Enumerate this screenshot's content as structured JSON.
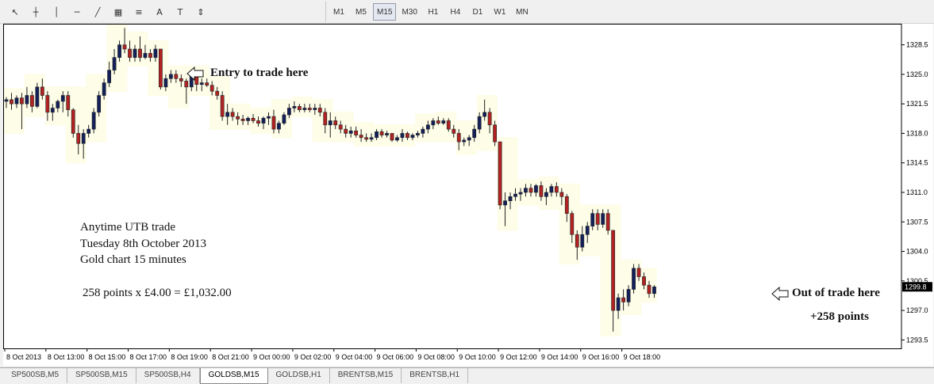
{
  "toolbar": {
    "tools": [
      {
        "name": "cursor-icon",
        "glyph": "↖"
      },
      {
        "name": "crosshair-icon",
        "glyph": "┼"
      },
      {
        "name": "vertical-line-icon",
        "glyph": "│"
      },
      {
        "name": "horizontal-line-icon",
        "glyph": "─"
      },
      {
        "name": "trendline-icon",
        "glyph": "╱"
      },
      {
        "name": "equidistant-channel-icon",
        "glyph": "▦"
      },
      {
        "name": "fibonacci-icon",
        "glyph": "≡"
      },
      {
        "name": "text-icon",
        "glyph": "A"
      },
      {
        "name": "text-label-icon",
        "glyph": "T"
      },
      {
        "name": "arrows-icon",
        "glyph": "⇕"
      }
    ],
    "timeframes": [
      "M1",
      "M5",
      "M15",
      "M30",
      "H1",
      "H4",
      "D1",
      "W1",
      "MN"
    ],
    "active_timeframe": "M15"
  },
  "chart_data": {
    "type": "candlestick",
    "symbol": "GOLDSB",
    "timeframe": "M15",
    "ylim": [
      1292.5,
      1331.0
    ],
    "y_ticks": [
      "1328.5",
      "1325.0",
      "1321.5",
      "1318.0",
      "1314.5",
      "1311.0",
      "1307.5",
      "1304.0",
      "1300.5",
      "1297.0",
      "1293.5"
    ],
    "current_price": "1299.8",
    "x_ticks": [
      "8 Oct 2013",
      "8 Oct 13:00",
      "8 Oct 15:00",
      "8 Oct 17:00",
      "8 Oct 19:00",
      "8 Oct 21:00",
      "9 Oct 00:00",
      "9 Oct 02:00",
      "9 Oct 04:00",
      "9 Oct 06:00",
      "9 Oct 08:00",
      "9 Oct 10:00",
      "9 Oct 12:00",
      "9 Oct 14:00",
      "9 Oct 16:00",
      "9 Oct 18:00"
    ],
    "candles": [
      [
        1321.8,
        1322.3,
        1321.0,
        1322.0
      ],
      [
        1322.0,
        1322.8,
        1320.8,
        1321.5
      ],
      [
        1321.5,
        1322.5,
        1321.0,
        1322.2
      ],
      [
        1322.2,
        1322.8,
        1318.5,
        1321.5
      ],
      [
        1321.5,
        1323.5,
        1321.0,
        1322.5
      ],
      [
        1322.5,
        1323.0,
        1320.5,
        1321.2
      ],
      [
        1321.2,
        1324.0,
        1321.0,
        1323.5
      ],
      [
        1323.5,
        1324.5,
        1322.0,
        1322.5
      ],
      [
        1322.5,
        1323.0,
        1319.5,
        1320.5
      ],
      [
        1320.5,
        1321.5,
        1319.5,
        1321.0
      ],
      [
        1321.0,
        1322.0,
        1320.5,
        1321.8
      ],
      [
        1321.8,
        1323.0,
        1320.5,
        1322.5
      ],
      [
        1322.5,
        1323.0,
        1320.0,
        1320.8
      ],
      [
        1320.8,
        1321.0,
        1317.5,
        1318.0
      ],
      [
        1318.0,
        1319.0,
        1315.5,
        1316.8
      ],
      [
        1316.8,
        1318.5,
        1315.0,
        1318.0
      ],
      [
        1318.0,
        1319.0,
        1317.5,
        1318.5
      ],
      [
        1318.5,
        1321.0,
        1318.0,
        1320.5
      ],
      [
        1320.5,
        1323.0,
        1320.0,
        1322.5
      ],
      [
        1322.5,
        1324.5,
        1322.0,
        1324.0
      ],
      [
        1324.0,
        1326.5,
        1323.5,
        1325.5
      ],
      [
        1325.5,
        1328.0,
        1325.0,
        1327.0
      ],
      [
        1327.0,
        1329.0,
        1326.5,
        1328.5
      ],
      [
        1328.5,
        1330.5,
        1327.5,
        1328.0
      ],
      [
        1328.0,
        1329.0,
        1326.5,
        1327.0
      ],
      [
        1327.0,
        1328.5,
        1326.5,
        1328.0
      ],
      [
        1328.0,
        1329.5,
        1326.5,
        1327.0
      ],
      [
        1327.0,
        1328.5,
        1326.8,
        1327.5
      ],
      [
        1327.5,
        1328.0,
        1326.5,
        1327.0
      ],
      [
        1327.0,
        1328.5,
        1326.5,
        1328.0
      ],
      [
        1328.0,
        1328.0,
        1323.2,
        1323.5
      ],
      [
        1323.5,
        1325.0,
        1323.0,
        1324.5
      ],
      [
        1324.5,
        1325.5,
        1324.0,
        1325.0
      ],
      [
        1325.0,
        1325.5,
        1324.0,
        1324.5
      ],
      [
        1324.5,
        1325.0,
        1323.5,
        1324.2
      ],
      [
        1324.2,
        1324.5,
        1321.5,
        1323.5
      ],
      [
        1323.5,
        1325.5,
        1323.0,
        1325.0
      ],
      [
        1325.0,
        1325.5,
        1323.0,
        1323.8
      ],
      [
        1323.8,
        1324.5,
        1323.0,
        1324.0
      ],
      [
        1324.0,
        1324.5,
        1323.5,
        1323.7
      ],
      [
        1323.7,
        1324.2,
        1322.5,
        1323.0
      ],
      [
        1323.0,
        1323.5,
        1322.0,
        1322.5
      ],
      [
        1322.5,
        1323.0,
        1319.5,
        1320.0
      ],
      [
        1320.0,
        1321.5,
        1319.0,
        1320.5
      ],
      [
        1320.5,
        1321.0,
        1319.5,
        1320.0
      ],
      [
        1320.0,
        1320.5,
        1319.0,
        1319.7
      ],
      [
        1319.7,
        1320.2,
        1319.0,
        1319.5
      ],
      [
        1319.5,
        1320.0,
        1319.0,
        1319.8
      ],
      [
        1319.8,
        1320.3,
        1319.2,
        1319.5
      ],
      [
        1319.5,
        1320.0,
        1318.8,
        1319.2
      ],
      [
        1319.2,
        1320.0,
        1318.5,
        1319.8
      ],
      [
        1319.8,
        1320.5,
        1319.0,
        1320.0
      ],
      [
        1320.0,
        1320.8,
        1318.0,
        1318.5
      ],
      [
        1318.5,
        1319.5,
        1318.0,
        1319.2
      ],
      [
        1319.2,
        1320.5,
        1319.0,
        1320.2
      ],
      [
        1320.2,
        1321.5,
        1319.8,
        1321.0
      ],
      [
        1321.0,
        1321.8,
        1320.5,
        1321.2
      ],
      [
        1321.2,
        1321.5,
        1320.5,
        1320.8
      ],
      [
        1320.8,
        1321.5,
        1320.5,
        1321.0
      ],
      [
        1321.0,
        1321.5,
        1320.5,
        1320.8
      ],
      [
        1320.8,
        1321.5,
        1320.2,
        1321.0
      ],
      [
        1321.0,
        1321.5,
        1320.0,
        1320.5
      ],
      [
        1320.5,
        1321.0,
        1318.0,
        1319.0
      ],
      [
        1319.0,
        1320.5,
        1317.5,
        1319.5
      ],
      [
        1319.5,
        1320.0,
        1318.5,
        1319.0
      ],
      [
        1319.0,
        1319.5,
        1318.0,
        1318.5
      ],
      [
        1318.5,
        1319.0,
        1317.5,
        1318.0
      ],
      [
        1318.0,
        1318.8,
        1317.5,
        1318.3
      ],
      [
        1318.3,
        1318.8,
        1317.5,
        1317.8
      ],
      [
        1317.8,
        1318.5,
        1317.0,
        1317.5
      ],
      [
        1317.5,
        1318.0,
        1317.0,
        1317.3
      ],
      [
        1317.3,
        1318.0,
        1317.0,
        1317.5
      ],
      [
        1317.5,
        1318.5,
        1317.2,
        1318.2
      ],
      [
        1318.2,
        1318.5,
        1317.5,
        1317.8
      ],
      [
        1317.8,
        1318.3,
        1317.5,
        1318.0
      ],
      [
        1318.0,
        1318.0,
        1317.0,
        1317.2
      ],
      [
        1317.2,
        1317.8,
        1317.0,
        1317.5
      ],
      [
        1317.5,
        1318.5,
        1317.0,
        1318.0
      ],
      [
        1318.0,
        1318.2,
        1317.2,
        1317.5
      ],
      [
        1317.5,
        1318.0,
        1317.2,
        1317.8
      ],
      [
        1317.8,
        1318.3,
        1317.5,
        1318.0
      ],
      [
        1318.0,
        1318.8,
        1317.5,
        1318.5
      ],
      [
        1318.5,
        1319.5,
        1318.0,
        1319.0
      ],
      [
        1319.0,
        1319.8,
        1318.5,
        1319.5
      ],
      [
        1319.5,
        1320.0,
        1319.0,
        1319.2
      ],
      [
        1319.2,
        1319.8,
        1319.0,
        1319.5
      ],
      [
        1319.5,
        1319.8,
        1318.2,
        1318.5
      ],
      [
        1318.5,
        1319.0,
        1317.5,
        1318.0
      ],
      [
        1318.0,
        1318.5,
        1316.0,
        1317.0
      ],
      [
        1317.0,
        1317.5,
        1316.5,
        1317.2
      ],
      [
        1317.2,
        1317.8,
        1316.5,
        1317.5
      ],
      [
        1317.5,
        1319.0,
        1317.0,
        1318.5
      ],
      [
        1318.5,
        1320.5,
        1318.0,
        1320.0
      ],
      [
        1320.0,
        1322.0,
        1319.5,
        1320.5
      ],
      [
        1320.5,
        1321.0,
        1318.0,
        1319.0
      ],
      [
        1319.0,
        1319.5,
        1316.5,
        1317.0
      ],
      [
        1317.0,
        1317.0,
        1309.0,
        1309.5
      ],
      [
        1309.5,
        1311.0,
        1307.0,
        1310.0
      ],
      [
        1310.0,
        1311.0,
        1309.0,
        1310.5
      ],
      [
        1310.5,
        1311.5,
        1310.0,
        1310.8
      ],
      [
        1310.8,
        1311.5,
        1310.0,
        1311.0
      ],
      [
        1311.0,
        1312.0,
        1310.5,
        1311.5
      ],
      [
        1311.5,
        1312.0,
        1310.5,
        1311.0
      ],
      [
        1311.0,
        1312.0,
        1310.5,
        1311.8
      ],
      [
        1311.8,
        1312.3,
        1310.0,
        1310.5
      ],
      [
        1310.5,
        1311.5,
        1309.5,
        1311.0
      ],
      [
        1311.0,
        1312.0,
        1310.5,
        1311.7
      ],
      [
        1311.7,
        1312.2,
        1310.5,
        1311.0
      ],
      [
        1311.0,
        1311.5,
        1309.5,
        1310.5
      ],
      [
        1310.5,
        1310.8,
        1307.5,
        1308.5
      ],
      [
        1308.5,
        1308.8,
        1305.0,
        1306.0
      ],
      [
        1306.0,
        1306.5,
        1303.0,
        1304.5
      ],
      [
        1304.5,
        1307.0,
        1304.0,
        1306.0
      ],
      [
        1306.0,
        1307.5,
        1305.0,
        1307.0
      ],
      [
        1307.0,
        1309.0,
        1306.5,
        1308.5
      ],
      [
        1308.5,
        1309.0,
        1306.5,
        1307.2
      ],
      [
        1307.2,
        1309.0,
        1306.8,
        1308.5
      ],
      [
        1308.5,
        1309.0,
        1306.0,
        1306.5
      ],
      [
        1306.5,
        1306.5,
        1294.5,
        1297.0
      ],
      [
        1297.0,
        1299.0,
        1296.0,
        1298.5
      ],
      [
        1298.5,
        1299.5,
        1297.0,
        1298.0
      ],
      [
        1298.0,
        1300.0,
        1297.5,
        1299.5
      ],
      [
        1299.5,
        1302.5,
        1299.0,
        1302.0
      ],
      [
        1302.0,
        1302.5,
        1300.5,
        1301.0
      ],
      [
        1301.0,
        1301.5,
        1299.5,
        1300.0
      ],
      [
        1300.0,
        1300.5,
        1298.5,
        1299.0
      ],
      [
        1299.0,
        1300.0,
        1298.5,
        1299.8
      ]
    ]
  },
  "annotations": {
    "entry": "Entry to trade here",
    "exit": "Out of trade here",
    "result": "+258 points",
    "info_lines": [
      "Anytime UTB trade",
      "Tuesday 8th October 2013",
      "Gold chart 15 minutes"
    ],
    "calc": "258 points x £4.00 = £1,032.00"
  },
  "tabs": [
    "SP500SB,M5",
    "SP500SB,M15",
    "SP500SB,H4",
    "GOLDSB,M15",
    "GOLDSB,H1",
    "BRENTSB,M15",
    "BRENTSB,H1"
  ],
  "active_tab": "GOLDSB,M15",
  "colors": {
    "bull": "#14205a",
    "bear": "#b22222",
    "highlight": "#fdfde8",
    "price_label_bg": "#000000"
  }
}
